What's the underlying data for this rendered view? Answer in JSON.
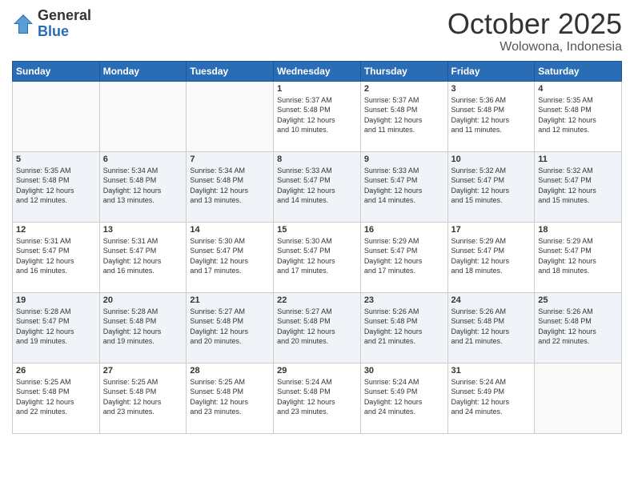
{
  "logo": {
    "general": "General",
    "blue": "Blue"
  },
  "header": {
    "month": "October 2025",
    "location": "Wolowona, Indonesia"
  },
  "days_of_week": [
    "Sunday",
    "Monday",
    "Tuesday",
    "Wednesday",
    "Thursday",
    "Friday",
    "Saturday"
  ],
  "weeks": [
    [
      {
        "day": "",
        "info": ""
      },
      {
        "day": "",
        "info": ""
      },
      {
        "day": "",
        "info": ""
      },
      {
        "day": "1",
        "info": "Sunrise: 5:37 AM\nSunset: 5:48 PM\nDaylight: 12 hours\nand 10 minutes."
      },
      {
        "day": "2",
        "info": "Sunrise: 5:37 AM\nSunset: 5:48 PM\nDaylight: 12 hours\nand 11 minutes."
      },
      {
        "day": "3",
        "info": "Sunrise: 5:36 AM\nSunset: 5:48 PM\nDaylight: 12 hours\nand 11 minutes."
      },
      {
        "day": "4",
        "info": "Sunrise: 5:35 AM\nSunset: 5:48 PM\nDaylight: 12 hours\nand 12 minutes."
      }
    ],
    [
      {
        "day": "5",
        "info": "Sunrise: 5:35 AM\nSunset: 5:48 PM\nDaylight: 12 hours\nand 12 minutes."
      },
      {
        "day": "6",
        "info": "Sunrise: 5:34 AM\nSunset: 5:48 PM\nDaylight: 12 hours\nand 13 minutes."
      },
      {
        "day": "7",
        "info": "Sunrise: 5:34 AM\nSunset: 5:48 PM\nDaylight: 12 hours\nand 13 minutes."
      },
      {
        "day": "8",
        "info": "Sunrise: 5:33 AM\nSunset: 5:47 PM\nDaylight: 12 hours\nand 14 minutes."
      },
      {
        "day": "9",
        "info": "Sunrise: 5:33 AM\nSunset: 5:47 PM\nDaylight: 12 hours\nand 14 minutes."
      },
      {
        "day": "10",
        "info": "Sunrise: 5:32 AM\nSunset: 5:47 PM\nDaylight: 12 hours\nand 15 minutes."
      },
      {
        "day": "11",
        "info": "Sunrise: 5:32 AM\nSunset: 5:47 PM\nDaylight: 12 hours\nand 15 minutes."
      }
    ],
    [
      {
        "day": "12",
        "info": "Sunrise: 5:31 AM\nSunset: 5:47 PM\nDaylight: 12 hours\nand 16 minutes."
      },
      {
        "day": "13",
        "info": "Sunrise: 5:31 AM\nSunset: 5:47 PM\nDaylight: 12 hours\nand 16 minutes."
      },
      {
        "day": "14",
        "info": "Sunrise: 5:30 AM\nSunset: 5:47 PM\nDaylight: 12 hours\nand 17 minutes."
      },
      {
        "day": "15",
        "info": "Sunrise: 5:30 AM\nSunset: 5:47 PM\nDaylight: 12 hours\nand 17 minutes."
      },
      {
        "day": "16",
        "info": "Sunrise: 5:29 AM\nSunset: 5:47 PM\nDaylight: 12 hours\nand 17 minutes."
      },
      {
        "day": "17",
        "info": "Sunrise: 5:29 AM\nSunset: 5:47 PM\nDaylight: 12 hours\nand 18 minutes."
      },
      {
        "day": "18",
        "info": "Sunrise: 5:29 AM\nSunset: 5:47 PM\nDaylight: 12 hours\nand 18 minutes."
      }
    ],
    [
      {
        "day": "19",
        "info": "Sunrise: 5:28 AM\nSunset: 5:47 PM\nDaylight: 12 hours\nand 19 minutes."
      },
      {
        "day": "20",
        "info": "Sunrise: 5:28 AM\nSunset: 5:48 PM\nDaylight: 12 hours\nand 19 minutes."
      },
      {
        "day": "21",
        "info": "Sunrise: 5:27 AM\nSunset: 5:48 PM\nDaylight: 12 hours\nand 20 minutes."
      },
      {
        "day": "22",
        "info": "Sunrise: 5:27 AM\nSunset: 5:48 PM\nDaylight: 12 hours\nand 20 minutes."
      },
      {
        "day": "23",
        "info": "Sunrise: 5:26 AM\nSunset: 5:48 PM\nDaylight: 12 hours\nand 21 minutes."
      },
      {
        "day": "24",
        "info": "Sunrise: 5:26 AM\nSunset: 5:48 PM\nDaylight: 12 hours\nand 21 minutes."
      },
      {
        "day": "25",
        "info": "Sunrise: 5:26 AM\nSunset: 5:48 PM\nDaylight: 12 hours\nand 22 minutes."
      }
    ],
    [
      {
        "day": "26",
        "info": "Sunrise: 5:25 AM\nSunset: 5:48 PM\nDaylight: 12 hours\nand 22 minutes."
      },
      {
        "day": "27",
        "info": "Sunrise: 5:25 AM\nSunset: 5:48 PM\nDaylight: 12 hours\nand 23 minutes."
      },
      {
        "day": "28",
        "info": "Sunrise: 5:25 AM\nSunset: 5:48 PM\nDaylight: 12 hours\nand 23 minutes."
      },
      {
        "day": "29",
        "info": "Sunrise: 5:24 AM\nSunset: 5:48 PM\nDaylight: 12 hours\nand 23 minutes."
      },
      {
        "day": "30",
        "info": "Sunrise: 5:24 AM\nSunset: 5:49 PM\nDaylight: 12 hours\nand 24 minutes."
      },
      {
        "day": "31",
        "info": "Sunrise: 5:24 AM\nSunset: 5:49 PM\nDaylight: 12 hours\nand 24 minutes."
      },
      {
        "day": "",
        "info": ""
      }
    ]
  ]
}
